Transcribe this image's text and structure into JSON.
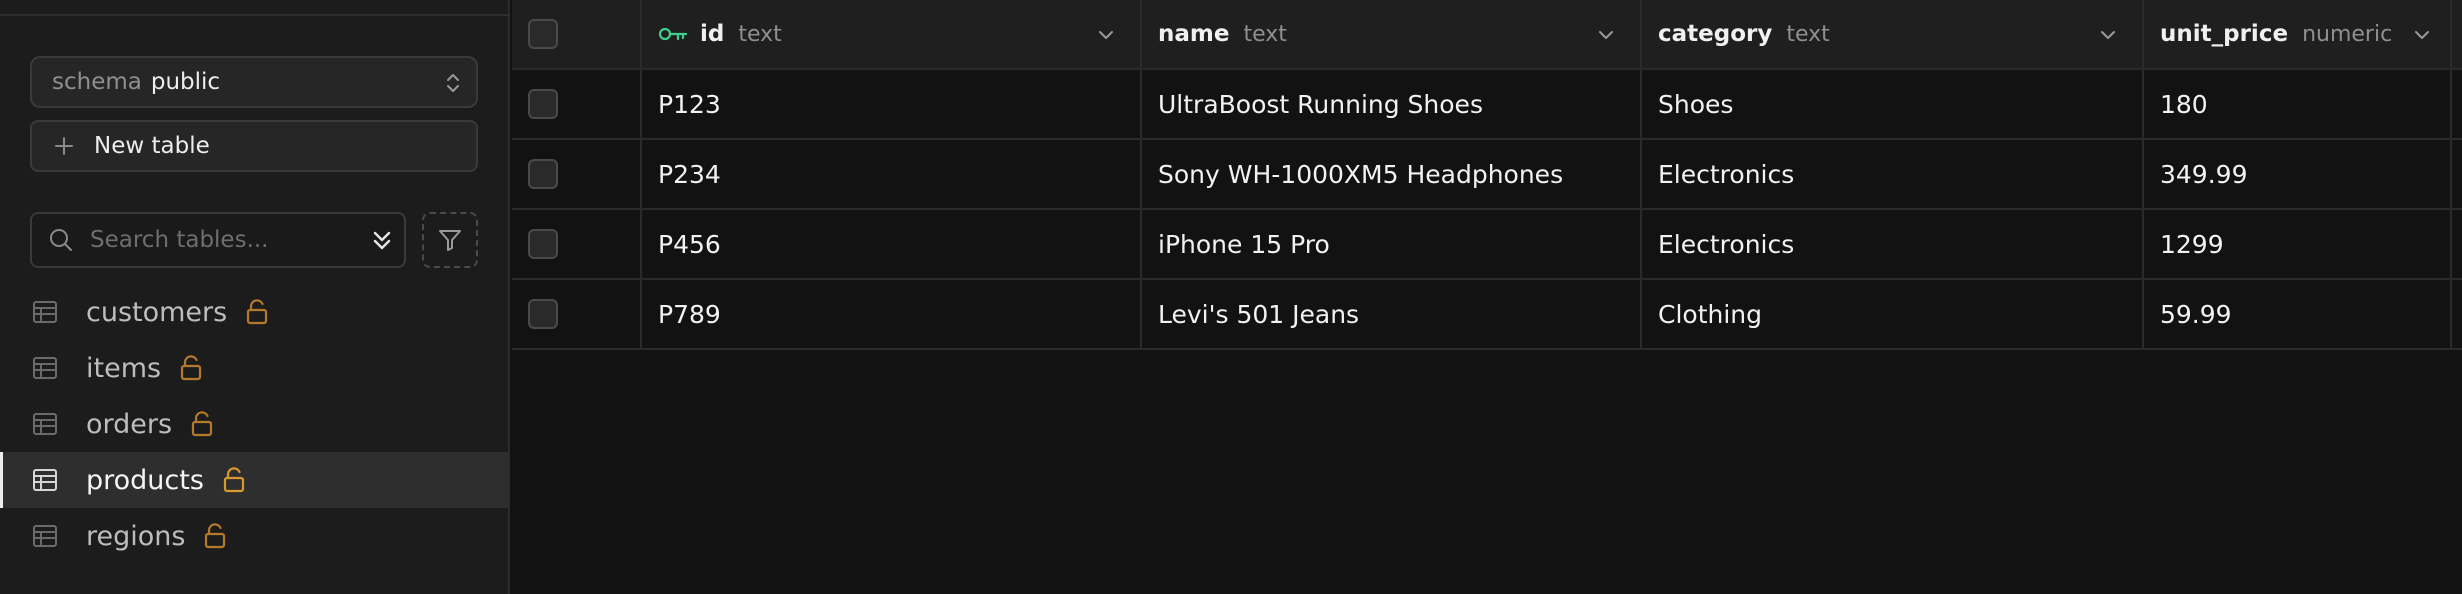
{
  "sidebar": {
    "schema_label": "schema",
    "schema_value": "public",
    "new_table_label": "New table",
    "search_placeholder": "Search tables...",
    "tables": [
      {
        "name": "customers",
        "icon": "table-icon",
        "lock_icon": "unlock-icon"
      },
      {
        "name": "items",
        "icon": "table-icon",
        "lock_icon": "unlock-icon"
      },
      {
        "name": "orders",
        "icon": "table-icon",
        "lock_icon": "unlock-icon"
      },
      {
        "name": "products",
        "icon": "table-icon",
        "lock_icon": "unlock-icon",
        "active": true
      },
      {
        "name": "regions",
        "icon": "table-icon",
        "lock_icon": "unlock-icon"
      }
    ]
  },
  "grid": {
    "columns": [
      {
        "name": "id",
        "type": "text",
        "primary_key": true
      },
      {
        "name": "name",
        "type": "text"
      },
      {
        "name": "category",
        "type": "text"
      },
      {
        "name": "unit_price",
        "type": "numeric"
      }
    ],
    "rows": [
      [
        "P123",
        "UltraBoost Running Shoes",
        "Shoes",
        "180"
      ],
      [
        "P234",
        "Sony WH-1000XM5 Headphones",
        "Electronics",
        "349.99"
      ],
      [
        "P456",
        "iPhone 15 Pro",
        "Electronics",
        "1299"
      ],
      [
        "P789",
        "Levi's 501 Jeans",
        "Clothing",
        "59.99"
      ]
    ]
  },
  "colors": {
    "accent_key": "#3ecf8e",
    "lock": "#b5792a",
    "active_lock": "#d9992f",
    "background": "#121212",
    "sidebar": "#1c1c1c"
  }
}
